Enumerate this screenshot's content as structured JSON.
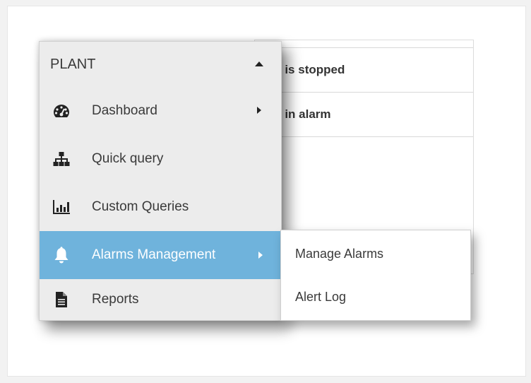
{
  "background_table": {
    "row1": "r is stopped",
    "row2": "r in alarm"
  },
  "menu": {
    "header": "PLANT",
    "items": [
      {
        "label": "Dashboard",
        "icon": "dashboard-gauge-icon",
        "has_submenu": true
      },
      {
        "label": "Quick query",
        "icon": "sitemap-icon",
        "has_submenu": false
      },
      {
        "label": "Custom Queries",
        "icon": "bar-chart-icon",
        "has_submenu": false
      },
      {
        "label": "Alarms Management",
        "icon": "bell-icon",
        "has_submenu": true,
        "active": true
      },
      {
        "label": "Reports",
        "icon": "document-icon",
        "has_submenu": false
      }
    ]
  },
  "submenu": {
    "items": [
      "Manage Alarms",
      "Alert Log"
    ]
  },
  "colors": {
    "active_bg": "#6fb3dc",
    "menu_bg": "#ececec",
    "text": "#3a3a3a"
  }
}
